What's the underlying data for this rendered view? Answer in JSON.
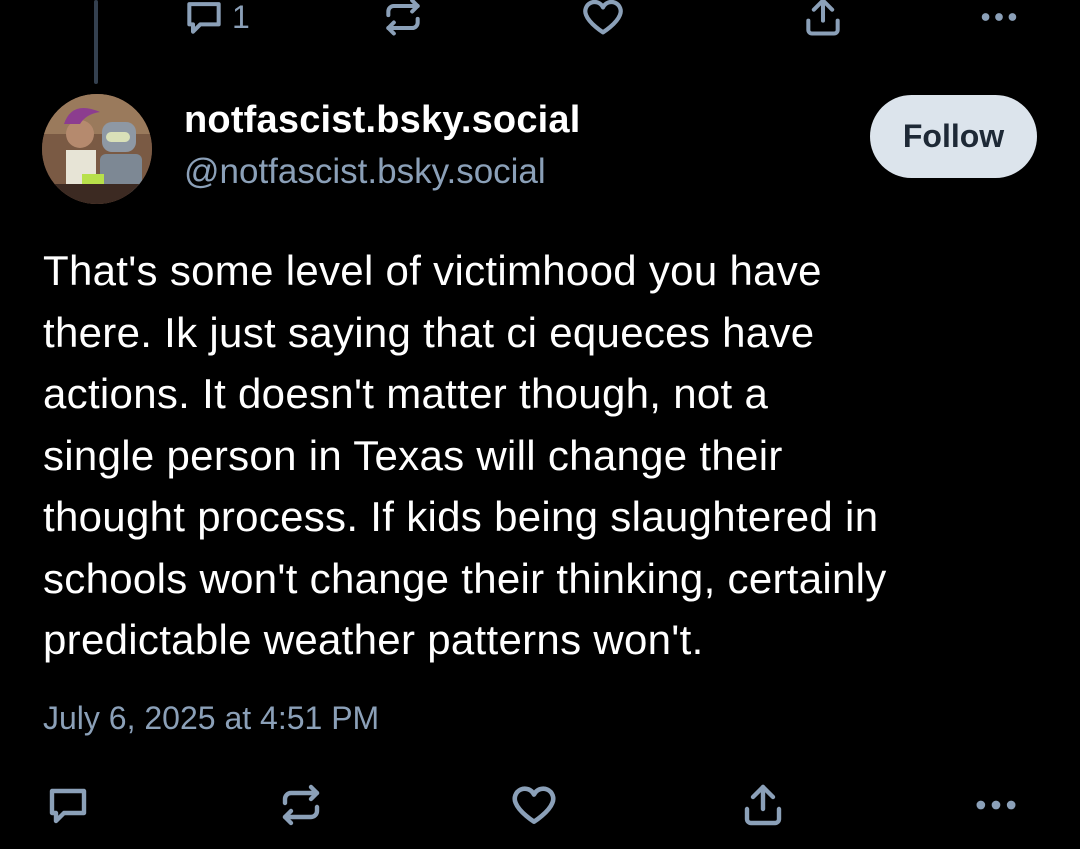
{
  "colors": {
    "background": "#000000",
    "text_primary": "#ffffff",
    "text_secondary": "#8ba0b8",
    "follow_button_bg": "#dce4ec",
    "follow_button_text": "#1e2936",
    "thread_line": "#34404f"
  },
  "parent_post": {
    "actions": {
      "reply_icon": "reply-icon",
      "reply_count": "1",
      "repost_icon": "repost-icon",
      "like_icon": "heart-icon",
      "share_icon": "share-icon",
      "more_icon": "more-icon"
    }
  },
  "post": {
    "author": {
      "display_name": "notfascist.bsky.social",
      "handle": "@notfascist.bsky.social",
      "avatar": "avatar-image"
    },
    "follow_label": "Follow",
    "text_lines": [
      "That's some level of victimhood you have",
      "there. Ik just saying that ci equeces have",
      "actions. It doesn't matter though, not a",
      "single person in Texas will change their",
      "thought process. If kids being slaughtered in",
      "schools won't change their thinking, certainly",
      "predictable weather patterns won't."
    ],
    "timestamp": "July 6, 2025 at 4:51 PM",
    "actions": {
      "reply_icon": "reply-icon",
      "repost_icon": "repost-icon",
      "like_icon": "heart-icon",
      "share_icon": "share-icon",
      "more_icon": "more-icon"
    }
  }
}
